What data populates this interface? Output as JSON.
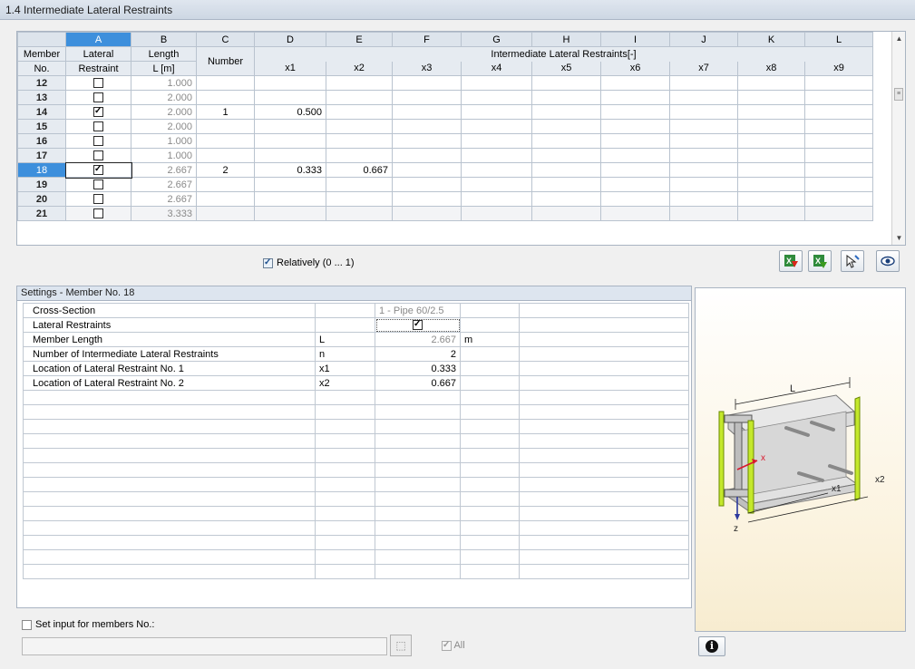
{
  "window": {
    "title": "1.4 Intermediate Lateral Restraints"
  },
  "grid": {
    "col_letters": [
      "A",
      "B",
      "C",
      "D",
      "E",
      "F",
      "G",
      "H",
      "I",
      "J",
      "K",
      "L"
    ],
    "header_member": "Member",
    "header_no": "No.",
    "header_lateral": "Lateral",
    "header_restraint": "Restraint",
    "header_length": "Length",
    "header_length_unit": "L [m]",
    "header_number": "Number",
    "header_group": "Intermediate Lateral Restraints[-]",
    "x_headers": [
      "x1",
      "x2",
      "x3",
      "x4",
      "x5",
      "x6",
      "x7",
      "x8",
      "x9"
    ],
    "rows": [
      {
        "no": "12",
        "restraint": false,
        "length": "1.000",
        "number": "",
        "x1": "",
        "x2": ""
      },
      {
        "no": "13",
        "restraint": false,
        "length": "2.000",
        "number": "",
        "x1": "",
        "x2": ""
      },
      {
        "no": "14",
        "restraint": true,
        "length": "2.000",
        "number": "1",
        "x1": "0.500",
        "x2": ""
      },
      {
        "no": "15",
        "restraint": false,
        "length": "2.000",
        "number": "",
        "x1": "",
        "x2": ""
      },
      {
        "no": "16",
        "restraint": false,
        "length": "1.000",
        "number": "",
        "x1": "",
        "x2": ""
      },
      {
        "no": "17",
        "restraint": false,
        "length": "1.000",
        "number": "",
        "x1": "",
        "x2": ""
      },
      {
        "no": "18",
        "restraint": true,
        "length": "2.667",
        "number": "2",
        "x1": "0.333",
        "x2": "0.667",
        "selected": true
      },
      {
        "no": "19",
        "restraint": false,
        "length": "2.667",
        "number": "",
        "x1": "",
        "x2": ""
      },
      {
        "no": "20",
        "restraint": false,
        "length": "2.667",
        "number": "",
        "x1": "",
        "x2": ""
      },
      {
        "no": "21",
        "restraint": false,
        "length": "3.333",
        "number": "",
        "x1": "",
        "x2": ""
      }
    ]
  },
  "relatively": {
    "label": "Relatively (0 ... 1)",
    "checked": true
  },
  "toolbar": {
    "icons": [
      "excel-export-icon",
      "excel-import-icon",
      "select-member-icon",
      "view-icon"
    ]
  },
  "settings": {
    "title": "Settings - Member No. 18",
    "rows": [
      {
        "label": "Cross-Section",
        "symbol": "",
        "value": "1 - Pipe 60/2.5",
        "unit": ""
      },
      {
        "label": "Lateral Restraints",
        "symbol": "",
        "value": "",
        "unit": "",
        "checkbox": true
      },
      {
        "label": "Member Length",
        "symbol": "L",
        "value": "2.667",
        "unit": "m"
      },
      {
        "label": "Number of Intermediate Lateral Restraints",
        "symbol": "n",
        "value": "2",
        "unit": ""
      },
      {
        "label": "Location of Lateral Restraint No. 1",
        "symbol": "x1",
        "value": "0.333",
        "unit": ""
      },
      {
        "label": "Location of Lateral Restraint No. 2",
        "symbol": "x2",
        "value": "0.667",
        "unit": ""
      }
    ],
    "empty_rows": 13
  },
  "set_input": {
    "label": "Set input for members No.:",
    "checked": false,
    "value": ""
  },
  "all": {
    "label": "All",
    "checked": true
  },
  "diagram": {
    "L": "L",
    "x": "x",
    "x1": "x1",
    "x2": "x2",
    "z": "z"
  },
  "colors": {
    "selection": "#3d8fdc",
    "header": "#e6ebf1",
    "support": "#c4e82b",
    "axis_x": "#d9182d",
    "axis_z": "#2d3a9e"
  }
}
